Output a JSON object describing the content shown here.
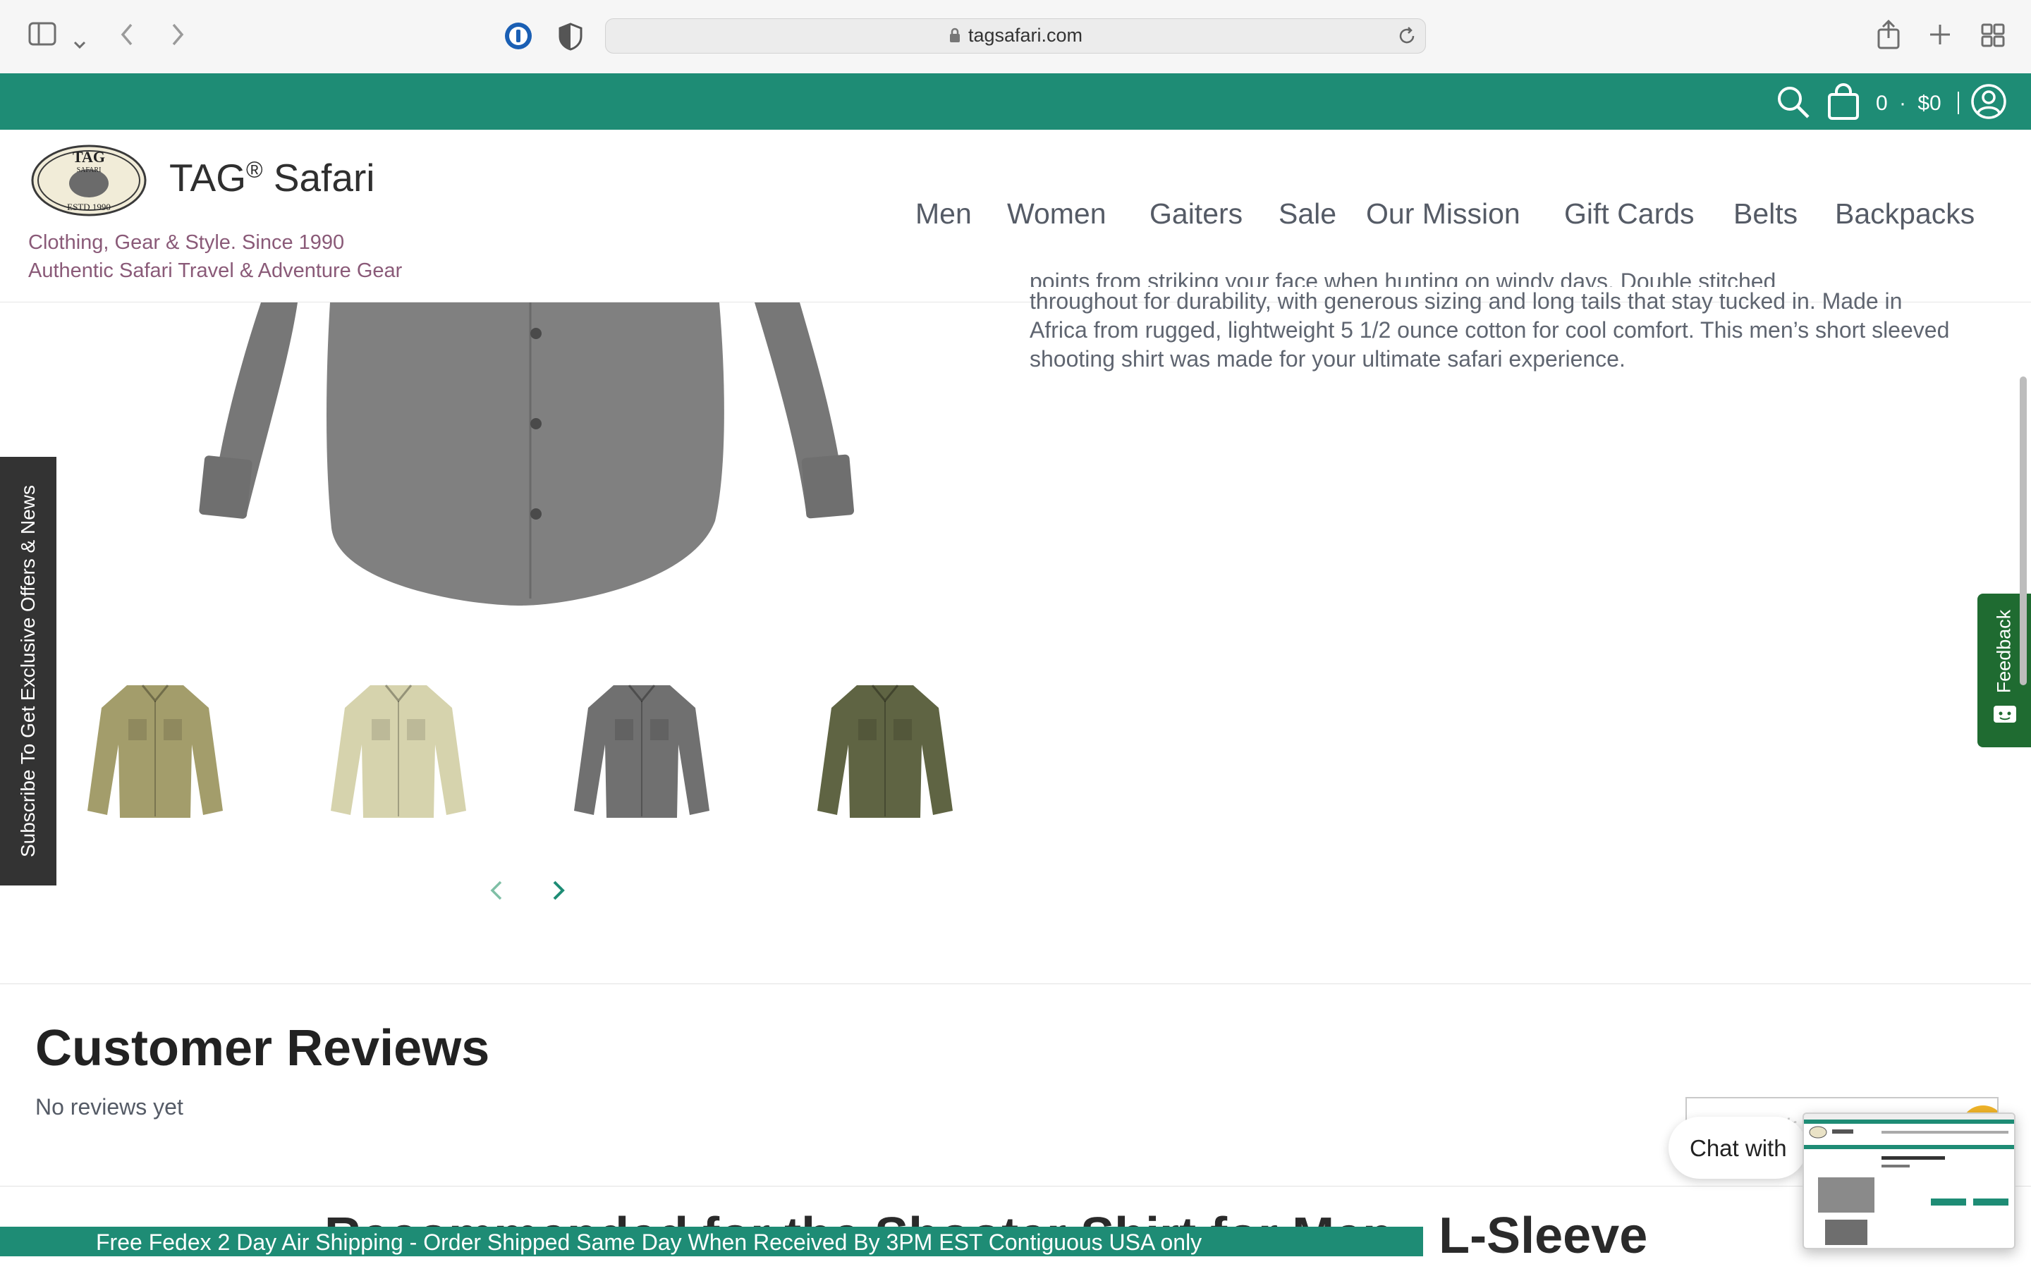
{
  "browser": {
    "url": "tagsafari.com"
  },
  "utility_bar": {
    "cart_count": "0",
    "cart_sep": "·",
    "cart_total": "$0",
    "color": "#1e8c75"
  },
  "header": {
    "logo_text": "TAG",
    "logo_sub": "SAFARI",
    "logo_est": "ESTD 1990",
    "brand": "TAG",
    "brand_mark": "®",
    "brand_suffix": "Safari",
    "tagline1": "Clothing, Gear & Style. Since 1990",
    "tagline2": "Authentic Safari Travel & Adventure Gear",
    "nav": [
      "Men",
      "Women",
      "Gaiters",
      "Sale",
      "Our Mission",
      "Gift Cards",
      "Belts",
      "Backpacks"
    ]
  },
  "product": {
    "description_partial": "points from striking your face when hunting on windy days. Double stitched",
    "description": "throughout for durability, with generous sizing and long tails that stay tucked in. Made in Africa from rugged, lightweight 5 1/2 ounce cotton for cool comfort. This men’s short sleeved shooting shirt was made for your ultimate safari experience.",
    "thumbnail_colors": [
      "#a39d6b",
      "#d6d3ad",
      "#707070",
      "#5f6443"
    ]
  },
  "side_tabs": {
    "subscribe": "Subscribe To Get Exclusive Offers & News",
    "feedback": "Feedback"
  },
  "reviews": {
    "title": "Customer Reviews",
    "empty": "No reviews yet",
    "write_button": "Wr"
  },
  "recommended_heading": "Recommended for the Shooter Shirt for Men - L-Sleeve",
  "shipping_banner": "Free Fedex 2 Day Air Shipping - Order Shipped Same Day When Received By 3PM EST Contiguous USA only",
  "chat_label": "Chat with"
}
